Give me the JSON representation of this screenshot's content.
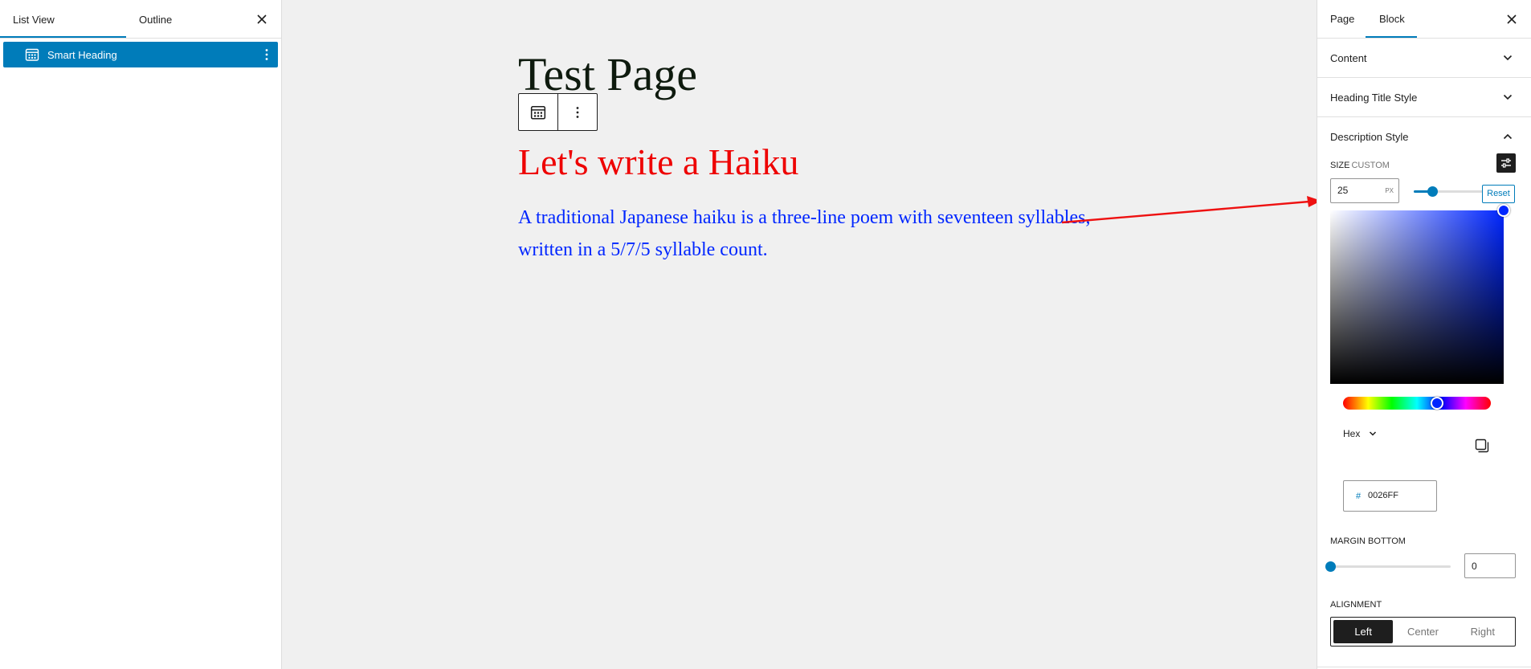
{
  "left_panel": {
    "tabs": [
      {
        "label": "List View"
      },
      {
        "label": "Outline"
      }
    ],
    "items": [
      {
        "label": "Smart Heading",
        "icon": "block-calendar-icon"
      }
    ]
  },
  "canvas": {
    "page_title": "Test Page",
    "heading": "Let's write a Haiku",
    "description": "A traditional Japanese haiku is a three-line poem with seventeen syllables, written in a 5/7/5 syllable count.",
    "heading_color": "#ee0000",
    "description_color": "#0026ff"
  },
  "right_panel": {
    "tabs": [
      {
        "label": "Page"
      },
      {
        "label": "Block"
      }
    ],
    "active_tab": "Block",
    "sections": [
      {
        "title": "Content",
        "expanded": false
      },
      {
        "title": "Heading Title Style",
        "expanded": false
      },
      {
        "title": "Description Style",
        "expanded": true
      }
    ],
    "size": {
      "label": "Size",
      "sublabel": "Custom",
      "value": "25",
      "unit": "PX",
      "slider_fraction": 0.25,
      "reset_label": "Reset"
    },
    "color_picker": {
      "hue_color": "#0026ff",
      "format_label": "Hex",
      "hash_symbol": "#",
      "hex_value": "0026FF"
    },
    "margin_bottom": {
      "label": "Margin Bottom",
      "value": "0",
      "slider_fraction": 0
    },
    "alignment": {
      "label": "Alignment",
      "options": [
        {
          "label": "Left"
        },
        {
          "label": "Center"
        },
        {
          "label": "Right"
        }
      ],
      "selected": "Left"
    }
  },
  "colors": {
    "accent": "#007cba",
    "annotation_arrow": "#ee1111"
  }
}
